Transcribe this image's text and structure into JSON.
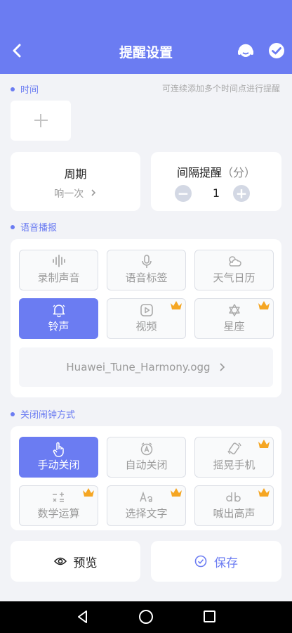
{
  "header": {
    "title": "提醒设置"
  },
  "time_section": {
    "title": "时间",
    "hint": "可连续添加多个时间点进行提醒"
  },
  "period": {
    "title": "周期",
    "value": "响一次"
  },
  "interval": {
    "title": "间隔提醒",
    "unit": "（分）",
    "value": "1",
    "minus": "−",
    "plus": "+"
  },
  "voice_section": {
    "title": "语音播报",
    "options": [
      {
        "label": "录制声音",
        "icon": "waveform-icon",
        "active": false,
        "premium": false
      },
      {
        "label": "语音标签",
        "icon": "microphone-icon",
        "active": false,
        "premium": false
      },
      {
        "label": "天气日历",
        "icon": "weather-icon",
        "active": false,
        "premium": false
      },
      {
        "label": "铃声",
        "icon": "bell-icon",
        "active": true,
        "premium": false
      },
      {
        "label": "视频",
        "icon": "video-icon",
        "active": false,
        "premium": true
      },
      {
        "label": "星座",
        "icon": "star-of-david-icon",
        "active": false,
        "premium": true
      }
    ],
    "ringtone": "Huawei_Tune_Harmony.ogg"
  },
  "close_section": {
    "title": "关闭闹钟方式",
    "options": [
      {
        "label": "手动关闭",
        "icon": "hand-pointer-icon",
        "active": true,
        "premium": false
      },
      {
        "label": "自动关闭",
        "icon": "auto-clock-icon",
        "active": false,
        "premium": false
      },
      {
        "label": "摇晃手机",
        "icon": "shake-phone-icon",
        "active": false,
        "premium": true
      },
      {
        "label": "数学运算",
        "icon": "math-ops-icon",
        "active": false,
        "premium": true
      },
      {
        "label": "选择文字",
        "icon": "text-aa-icon",
        "active": false,
        "premium": true
      },
      {
        "label": "喊出高声",
        "icon": "decibel-icon",
        "active": false,
        "premium": true
      }
    ]
  },
  "bottom": {
    "preview_label": "预览",
    "save_label": "保存"
  },
  "colors": {
    "accent": "#6b7cf2",
    "crown": "#f5a623",
    "background": "#f2f3f7"
  }
}
